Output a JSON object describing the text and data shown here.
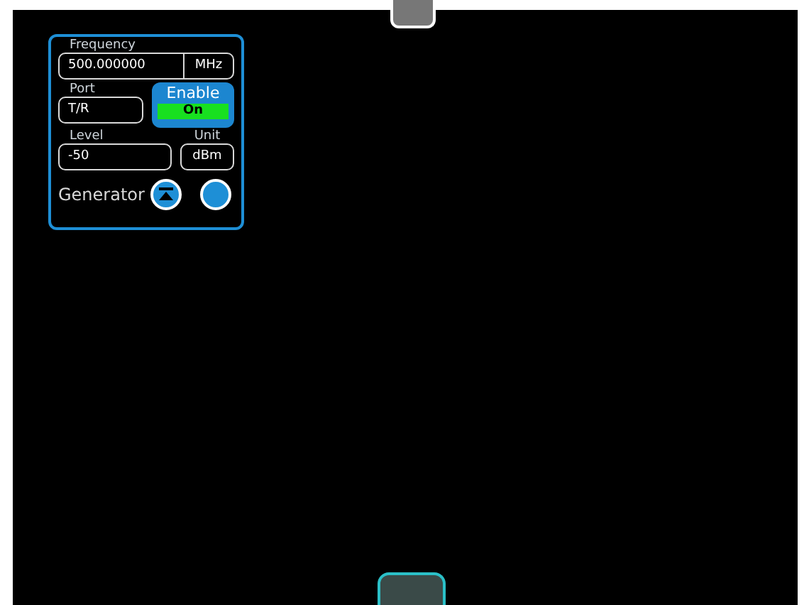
{
  "generator_panel": {
    "title": "Generator",
    "frequency": {
      "label": "Frequency",
      "value": "500.000000",
      "unit": "MHz"
    },
    "port": {
      "label": "Port",
      "value": "T/R"
    },
    "enable": {
      "label": "Enable",
      "state": "On",
      "on": true
    },
    "level": {
      "label": "Level",
      "value": "-50"
    },
    "unit": {
      "label": "Unit",
      "value": "dBm"
    }
  }
}
